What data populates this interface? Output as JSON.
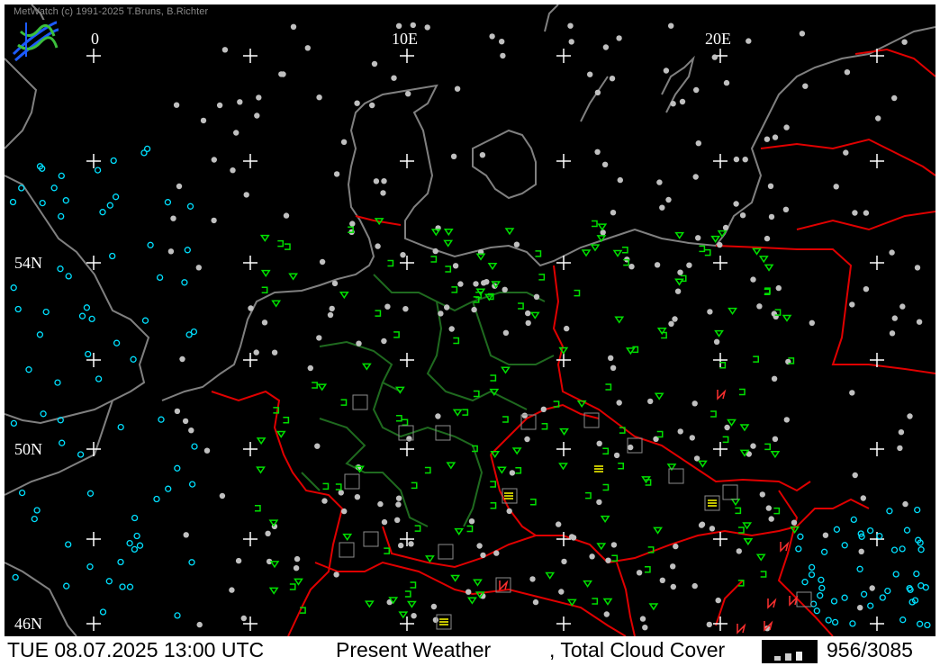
{
  "header": {
    "copyright": "MetWatch  (c) 1991-2025 T.Bruns, B.Richter"
  },
  "grid_labels": {
    "lon_0": "0",
    "lon_10e": "10E",
    "lon_20e": "20E",
    "lat_54n": "54N",
    "lat_50n": "50N",
    "lat_46n": "46N"
  },
  "status": {
    "datetime": "TUE 08.07.2025 13:00 UTC",
    "layer1": "Present Weather",
    "layer2": ", Total Cloud Cover",
    "count": "956/3085"
  },
  "colors": {
    "background": "#000000",
    "coastline": "#808080",
    "country_border": "#e00000",
    "state_border": "#1f6a1f",
    "grid_cross": "#ffffff",
    "cloud_overcast": "#c0c0c0",
    "cloud_clear": "#00e0ff",
    "weather_green": "#00e000",
    "weather_yellow": "#ffff00",
    "weather_red": "#ff3030"
  },
  "icons": {
    "logo": "metwatch-logo-icon",
    "legend": "cloud-cover-legend-icon"
  }
}
